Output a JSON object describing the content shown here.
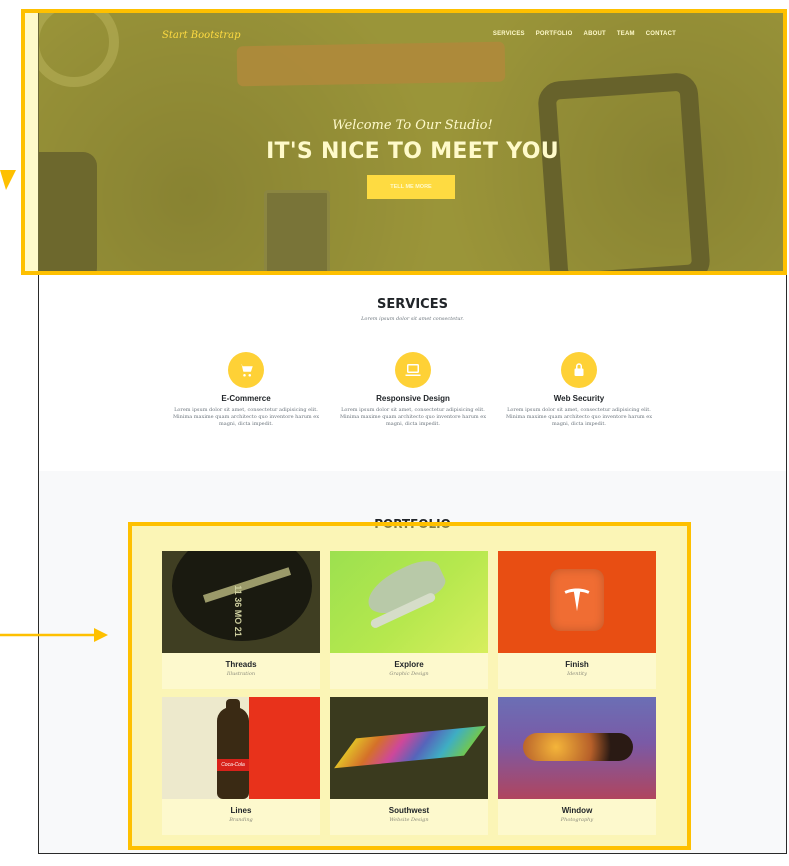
{
  "brand": "Start Bootstrap",
  "nav": [
    "SERVICES",
    "PORTFOLIO",
    "ABOUT",
    "TEAM",
    "CONTACT"
  ],
  "hero": {
    "subheading": "Welcome To Our Studio!",
    "heading": "IT'S NICE TO MEET YOU",
    "button": "TELL ME MORE"
  },
  "services": {
    "title": "SERVICES",
    "subtitle": "Lorem ipsum dolor sit amet consectetur.",
    "items": [
      {
        "name": "E-Commerce",
        "icon": "shopping-cart-icon",
        "desc": "Lorem ipsum dolor sit amet, consectetur adipisicing elit. Minima maxime quam architecto quo inventore harum ex magni, dicta impedit."
      },
      {
        "name": "Responsive Design",
        "icon": "laptop-icon",
        "desc": "Lorem ipsum dolor sit amet, consectetur adipisicing elit. Minima maxime quam architecto quo inventore harum ex magni, dicta impedit."
      },
      {
        "name": "Web Security",
        "icon": "lock-icon",
        "desc": "Lorem ipsum dolor sit amet, consectetur adipisicing elit. Minima maxime quam architecto quo inventore harum ex magni, dicta impedit."
      }
    ]
  },
  "portfolio": {
    "title": "PORTFOLIO",
    "items": [
      {
        "title": "Threads",
        "category": "Illustration"
      },
      {
        "title": "Explore",
        "category": "Graphic Design"
      },
      {
        "title": "Finish",
        "category": "Identity"
      },
      {
        "title": "Lines",
        "category": "Branding"
      },
      {
        "title": "Southwest",
        "category": "Website Design"
      },
      {
        "title": "Window",
        "category": "Photography"
      }
    ]
  },
  "bottle_label": "Coca-Cola",
  "watch_text": "11 36 MO 21",
  "colors": {
    "accent": "#fed136",
    "highlight": "#fec000"
  }
}
